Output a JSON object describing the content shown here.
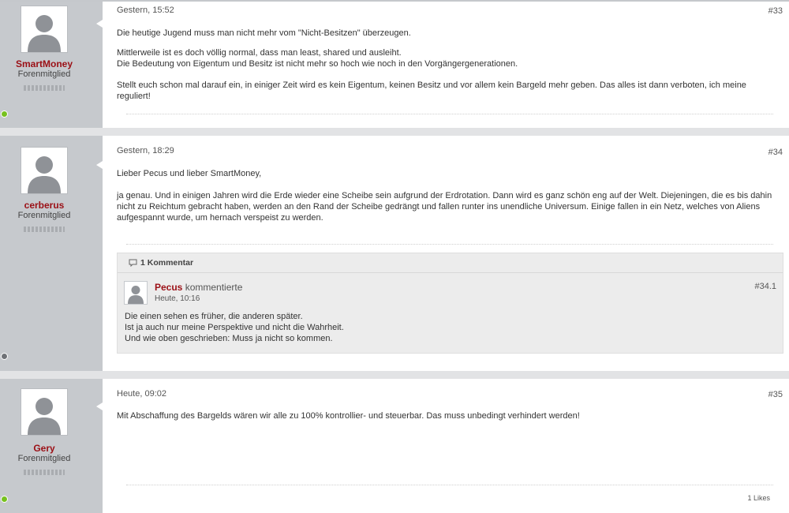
{
  "posts": [
    {
      "author": "SmartMoney",
      "user_title": "Forenmitglied",
      "online_color": "#77c11f",
      "date": "Gestern, 15:52",
      "number": "#33",
      "lines": [
        "Die heutige Jugend muss man nicht mehr vom \"Nicht-Besitzen\" überzeugen.",
        "Mittlerweile ist es doch völlig normal, dass man least, shared und ausleiht.",
        "Die Bedeutung von Eigentum und Besitz ist nicht mehr so hoch wie noch in den Vorgängergenerationen.",
        "Stellt euch schon mal darauf ein, in einiger Zeit wird es kein Eigentum, keinen Besitz und vor allem kein Bargeld mehr geben. Das alles ist dann verboten, ich meine reguliert!"
      ]
    },
    {
      "author": "cerberus",
      "user_title": "Forenmitglied",
      "online_color": "#8a8d92",
      "date": "Gestern, 18:29",
      "number": "#34",
      "lines": [
        "Lieber Pecus und lieber SmartMoney,",
        "ja genau. Und in einigen Jahren wird die Erde wieder eine Scheibe sein aufgrund der Erdrotation. Dann wird es ganz schön eng auf der Welt. Diejeningen, die es bis dahin nicht zu Reichtum gebracht haben, werden an den Rand der Scheibe gedrängt und fallen runter ins unendliche Universum. Einige fallen in ein Netz, welches von Aliens aufgespannt wurde, um hernach verspeist zu werden."
      ],
      "comments": {
        "header": "1 Kommentar",
        "author": "Pecus",
        "verb": "kommentierte",
        "date": "Heute, 10:16",
        "number": "#34.1",
        "lines": [
          "Die einen sehen es früher, die anderen später.",
          "Ist ja auch nur meine Perspektive und nicht die Wahrheit.",
          "Und wie oben geschrieben: Muss ja nicht so kommen."
        ]
      }
    },
    {
      "author": "Gery",
      "user_title": "Forenmitglied",
      "online_color": "#77c11f",
      "date": "Heute, 09:02",
      "number": "#35",
      "lines": [
        "Mit Abschaffung des Bargelds wären wir alle zu 100% kontrollier- und steuerbar. Das muss unbedingt verhindert werden!"
      ],
      "likes": "1 Likes"
    }
  ]
}
